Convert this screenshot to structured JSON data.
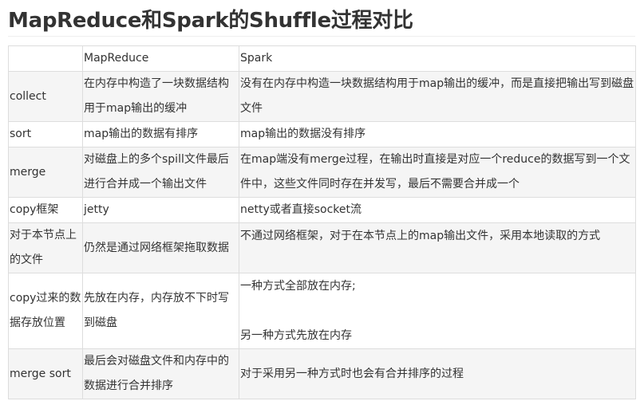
{
  "page": {
    "title": "MapReduce和Spark的Shuffle过程对比"
  },
  "table": {
    "headers": [
      "",
      "MapReduce",
      "Spark"
    ],
    "rows": [
      {
        "item": "collect",
        "mapreduce": "在内存中构造了一块数据结构用于map输出的缓冲",
        "spark": "没有在内存中构造一块数据结构用于map输出的缓冲，而是直接把输出写到磁盘文件"
      },
      {
        "item": "sort",
        "mapreduce": "map输出的数据有排序",
        "spark": "map输出的数据没有排序"
      },
      {
        "item": "merge",
        "mapreduce": "对磁盘上的多个spill文件最后进行合并成一个输出文件",
        "spark": "在map端没有merge过程，在输出时直接是对应一个reduce的数据写到一个文件中，这些文件同时存在并发写，最后不需要合并成一个"
      },
      {
        "item": "copy框架",
        "mapreduce": "jetty",
        "spark": "netty或者直接socket流"
      },
      {
        "item": "对于本节点上的文件",
        "mapreduce": "仍然是通过网络框架拖取数据",
        "spark": "不通过网络框架，对于在本节点上的map输出文件，采用本地读取的方式"
      },
      {
        "item": "copy过来的数据存放位置",
        "mapreduce": "先放在内存，内存放不下时写到磁盘",
        "spark_line1": "一种方式全部放在内存;",
        "spark_line2": "另一种方式先放在内存"
      },
      {
        "item": "merge sort",
        "mapreduce": "最后会对磁盘文件和内存中的数据进行合并排序",
        "spark": "对于采用另一种方式时也会有合并排序的过程"
      }
    ]
  }
}
